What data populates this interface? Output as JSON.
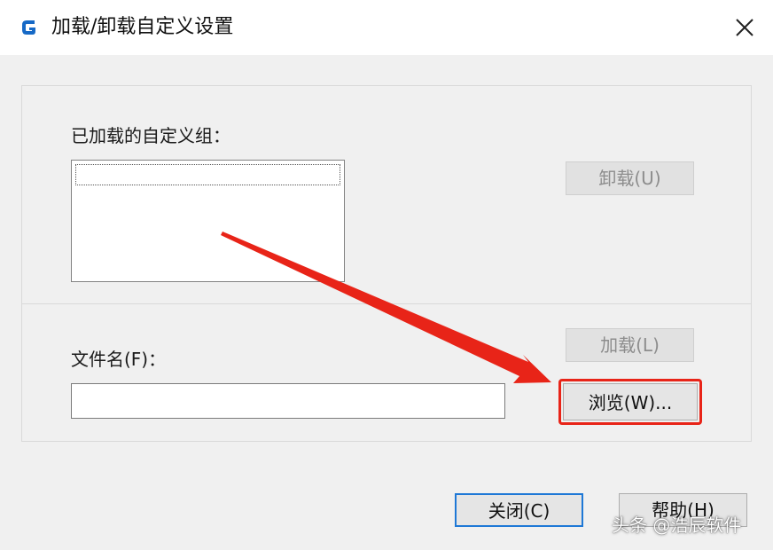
{
  "window": {
    "title": "加载/卸载自定义设置",
    "icon": "app-logo-icon",
    "close_icon": "close-icon"
  },
  "loaded_groups": {
    "label": "已加载的自定义组：",
    "items": [
      ""
    ],
    "unload_button": "卸载(U)"
  },
  "file": {
    "label": "文件名(F)：",
    "value": "",
    "load_button": "加载(L)",
    "browse_button": "浏览(W)..."
  },
  "footer": {
    "close_button": "关闭(C)",
    "help_button": "帮助(H)"
  },
  "annotation": {
    "arrow_color": "#e82418",
    "highlight_color": "#e82418"
  },
  "watermark": "头条 @浩辰软件"
}
